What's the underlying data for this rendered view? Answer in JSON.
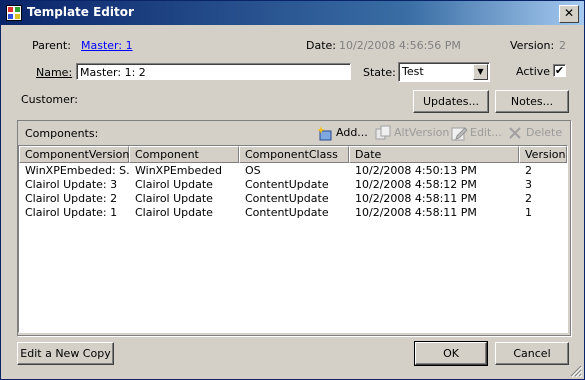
{
  "window": {
    "title": "Template Editor"
  },
  "form": {
    "parent_label": "Parent:",
    "parent_value": "Master: 1",
    "date_label": "Date:",
    "date_value": "10/2/2008 4:56:56 PM",
    "version_label": "Version:",
    "version_value": "2",
    "name_label": "Name:",
    "name_value": "Master: 1: 2",
    "state_label": "State:",
    "state_value": "Test",
    "active_label": "Active",
    "active_checked": "✔",
    "customer_label": "Customer:",
    "updates_button": "Updates...",
    "notes_button": "Notes..."
  },
  "components": {
    "label": "Components:",
    "toolbar": {
      "add": "Add...",
      "altversion": "AltVersion",
      "edit": "Edit...",
      "delete": "Delete"
    },
    "columns": [
      "ComponentVersion",
      "Component",
      "ComponentClass",
      "Date",
      "Version"
    ],
    "rows": [
      [
        "WinXPEmbeded: S...",
        "WinXPEmbeded",
        "OS",
        "10/2/2008 4:50:13 PM",
        "2"
      ],
      [
        "Clairol Update: 3",
        "Clairol Update",
        "ContentUpdate",
        "10/2/2008 4:58:12 PM",
        "3"
      ],
      [
        "Clairol Update: 2",
        "Clairol Update",
        "ContentUpdate",
        "10/2/2008 4:58:11 PM",
        "2"
      ],
      [
        "Clairol Update: 1",
        "Clairol Update",
        "ContentUpdate",
        "10/2/2008 4:58:11 PM",
        "1"
      ]
    ]
  },
  "footer": {
    "edit_copy_button": "Edit a New Copy",
    "ok_button": "OK",
    "cancel_button": "Cancel"
  },
  "icons": {
    "app": "form-icon",
    "add": "add-icon",
    "altversion": "altversion-icon",
    "edit": "edit-icon",
    "delete": "delete-icon",
    "close": "close-icon",
    "grip": "resize-grip-icon"
  }
}
